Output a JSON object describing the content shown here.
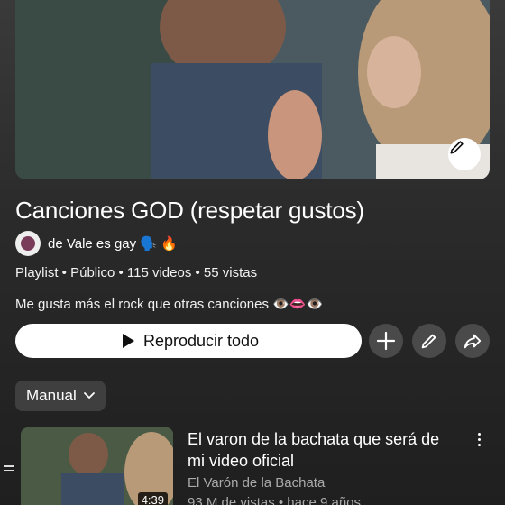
{
  "playlist": {
    "title": "Canciones GOD (respetar gustos)",
    "owner": "de Vale es gay 🗣️ 🔥",
    "meta": "Playlist • Público • 115 videos • 55 vistas",
    "description": "Me gusta más el rock que otras canciones 👁️👄👁️"
  },
  "actions": {
    "play_all": "Reproducir todo",
    "sort_label": "Manual"
  },
  "icons": {
    "hero_edit": "pencil-icon",
    "play": "play-icon",
    "add": "plus-icon",
    "edit": "pencil-icon",
    "share": "share-icon",
    "sort": "chevron-down-icon",
    "drag": "drag-handle-icon",
    "more": "more-vert-icon"
  },
  "videos": [
    {
      "title": "El varon de la bachata que será de mi video oficial",
      "channel": "El Varón de la Bachata",
      "stats": "93 M de vistas • hace 9 años",
      "duration": "4:39"
    }
  ],
  "colors": {
    "button_bg": "#ffffff",
    "circle_bg": "#4a4a4a",
    "chip_bg": "#3f3f3f",
    "secondary_text": "#aaaaaa"
  }
}
